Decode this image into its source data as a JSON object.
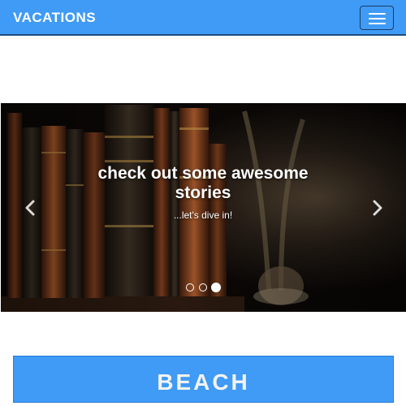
{
  "navbar": {
    "brand": "VACATIONS",
    "toggler_icon": "hamburger-menu-icon",
    "color": "#3f9bf5"
  },
  "carousel": {
    "slide_title": "check out some awesome stories",
    "slide_subtitle": "...let's dive in!",
    "prev_icon": "chevron-left-icon",
    "next_icon": "chevron-right-icon",
    "slide_count": 3,
    "active_slide": 3
  },
  "sections": [
    {
      "label": "BEACH"
    }
  ]
}
